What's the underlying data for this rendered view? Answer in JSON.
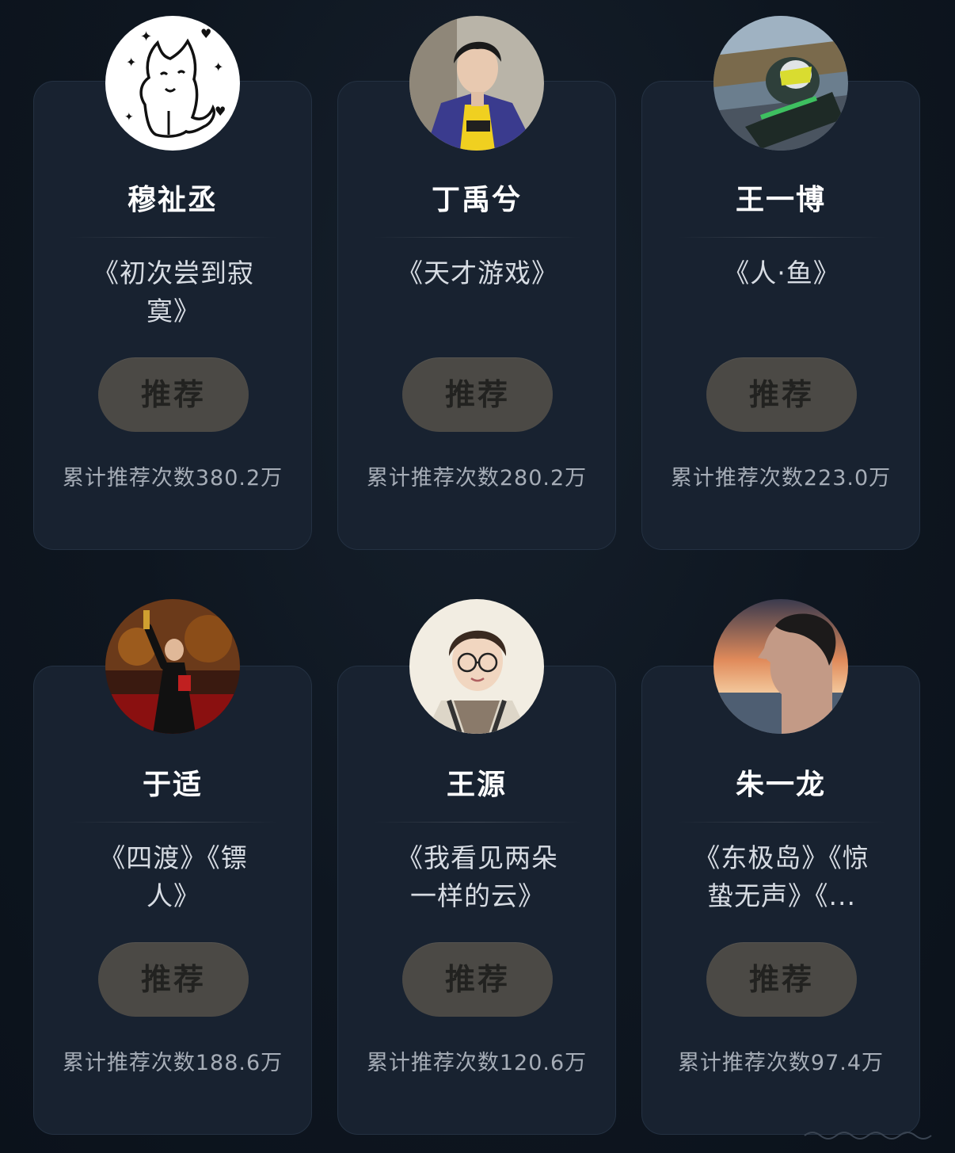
{
  "cards": [
    {
      "name": "穆祉丞",
      "works": "《初次尝到寂寞》",
      "button": "推荐",
      "count": "累计推荐次数380.2万",
      "avatar": "cat-doodle-avatar"
    },
    {
      "name": "丁禹兮",
      "works": "《天才游戏》",
      "button": "推荐",
      "count": "累计推荐次数280.2万",
      "avatar": "portrait-avatar"
    },
    {
      "name": "王一博",
      "works": "《人·鱼》",
      "button": "推荐",
      "count": "累计推荐次数223.0万",
      "avatar": "motorcycle-avatar"
    },
    {
      "name": "于适",
      "works": "《四渡》《镖人》",
      "button": "推荐",
      "count": "累计推荐次数188.6万",
      "avatar": "stage-avatar"
    },
    {
      "name": "王源",
      "works": "《我看见两朵一样的云》",
      "button": "推荐",
      "count": "累计推荐次数120.6万",
      "avatar": "glasses-portrait-avatar"
    },
    {
      "name": "朱一龙",
      "works": "《东极岛》《惊蛰无声》《...",
      "button": "推荐",
      "count": "累计推荐次数97.4万",
      "avatar": "sunset-profile-avatar"
    }
  ]
}
